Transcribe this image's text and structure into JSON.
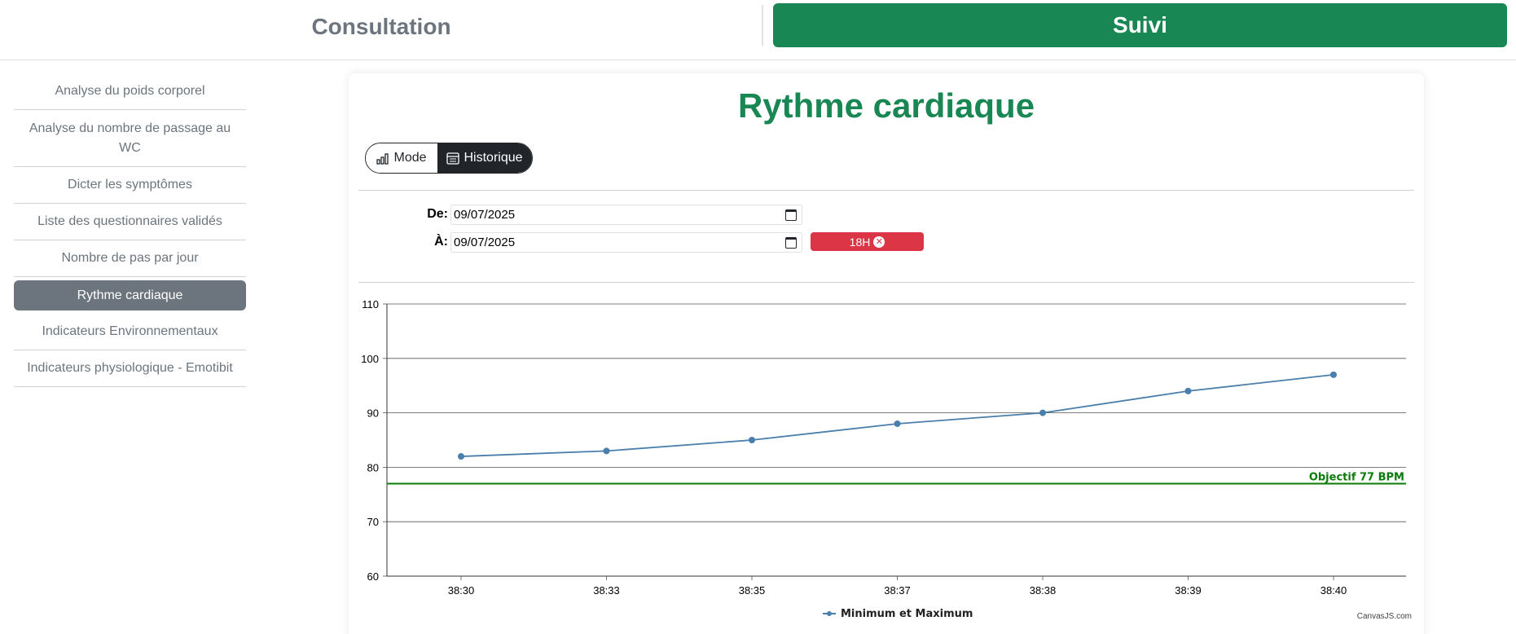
{
  "header": {
    "consultation_label": "Consultation",
    "suivi_label": "Suivi"
  },
  "sidebar": {
    "items": [
      {
        "label": "Analyse du poids corporel"
      },
      {
        "label": "Analyse du nombre de passage au WC"
      },
      {
        "label": "Dicter les symptômes"
      },
      {
        "label": "Liste des questionnaires validés"
      },
      {
        "label": "Nombre de pas par jour"
      },
      {
        "label": "Rythme cardiaque"
      },
      {
        "label": "Indicateurs Environnementaux"
      },
      {
        "label": "Indicateurs physiologique - Emotibit"
      }
    ],
    "active_index": 5
  },
  "main": {
    "title": "Rythme cardiaque",
    "toggle": {
      "mode_label": "Mode",
      "history_label": "Historique"
    },
    "filter": {
      "from_label": "De:",
      "from_value": "09/07/2025",
      "to_label": "À:",
      "to_value": "09/07/2025",
      "badge_label": "18H"
    },
    "credit": "CanvasJS.com"
  },
  "colors": {
    "primary_green": "#198754",
    "danger_red": "#dc3545",
    "series_blue": "#4a7eab",
    "goal_green": "#0a7a0a"
  },
  "chart_data": {
    "type": "line",
    "x": [
      "38:30",
      "38:33",
      "38:35",
      "38:37",
      "38:38",
      "38:39",
      "38:40"
    ],
    "series": [
      {
        "name": "Minimum et Maximum",
        "values": [
          82,
          83,
          85,
          88,
          90,
          94,
          97
        ]
      }
    ],
    "ylim": [
      60,
      110
    ],
    "yticks": [
      60,
      70,
      80,
      90,
      100,
      110
    ],
    "grid": true,
    "legend": "bottom-center",
    "goal_line": {
      "value": 77,
      "label": "Objectif 77 BPM"
    }
  }
}
